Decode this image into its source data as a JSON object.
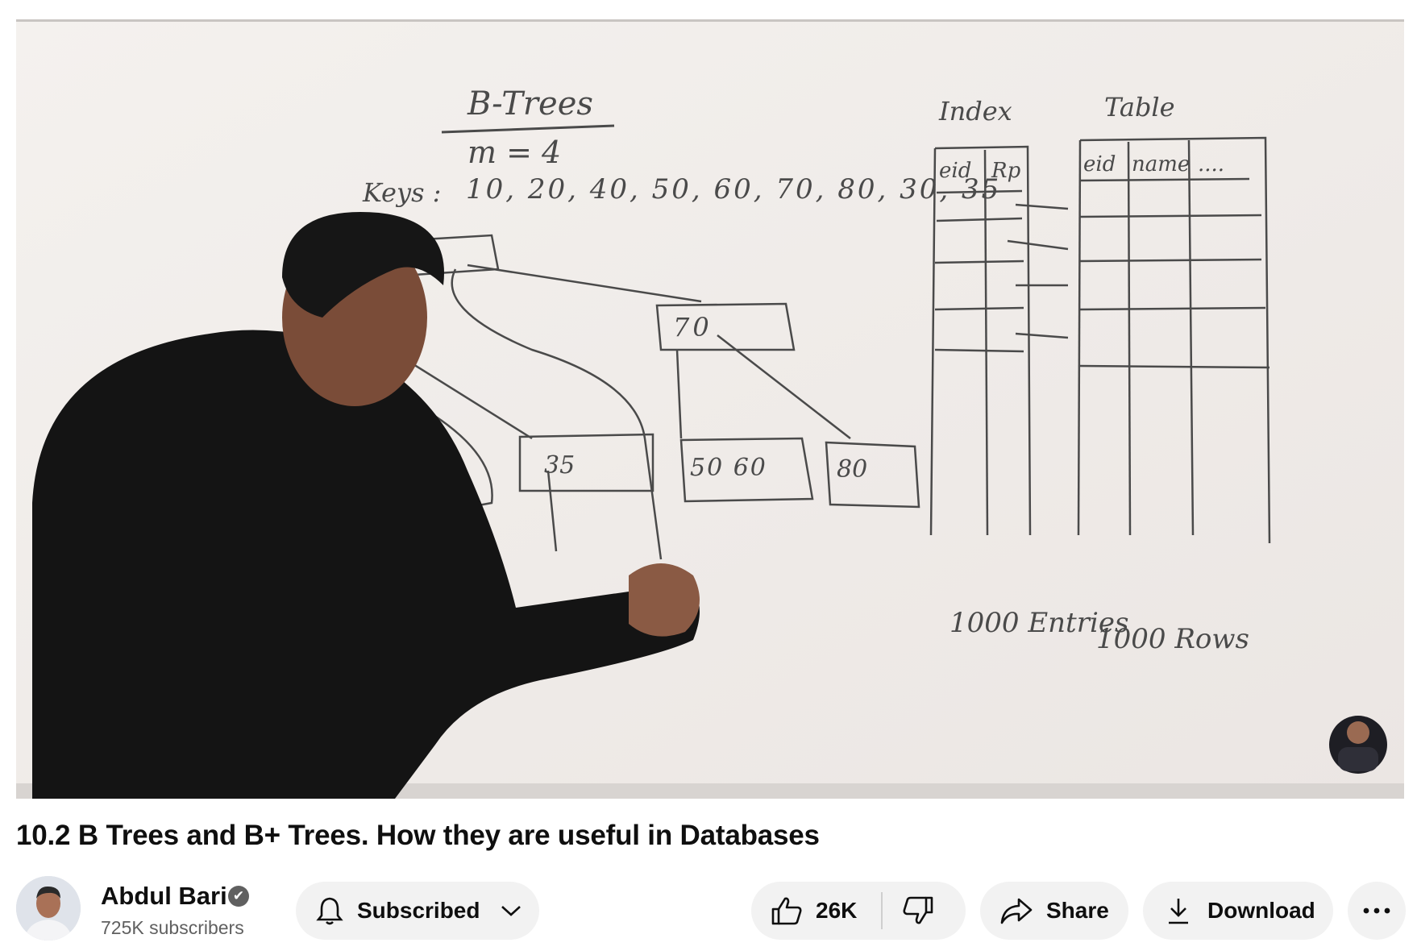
{
  "video": {
    "board": {
      "title": "B-Trees",
      "order": "m = 4",
      "keys_label": "Keys :",
      "keys": "10, 20, 40, 50, 60, 70, 80, 30, 35",
      "root_node": "70",
      "leaf_1": "35",
      "leaf_2": "50  60",
      "leaf_3": "80",
      "index_label": "Index",
      "table_label": "Table",
      "index_col_1": "eid",
      "index_col_2": "Rp",
      "table_col_1": "eid",
      "table_col_2": "name",
      "table_col_3": "....",
      "index_count": "1000 Entries",
      "table_count": "1000 Rows"
    }
  },
  "title": "10.2 B Trees and B+ Trees. How they are useful in Databases",
  "channel": {
    "name": "Abdul Bari",
    "verified_icon": "✔",
    "subscribers": "725K subscribers"
  },
  "actions": {
    "subscribe_label": "Subscribed",
    "like_count": "26K",
    "share_label": "Share",
    "download_label": "Download"
  },
  "icons": {
    "subscribe": "bell-icon",
    "subscribe_menu": "chevron-down-icon",
    "like": "thumbs-up-icon",
    "dislike": "thumbs-down-icon",
    "share": "share-arrow-icon",
    "download": "download-icon",
    "more": "more-horizontal-icon"
  }
}
